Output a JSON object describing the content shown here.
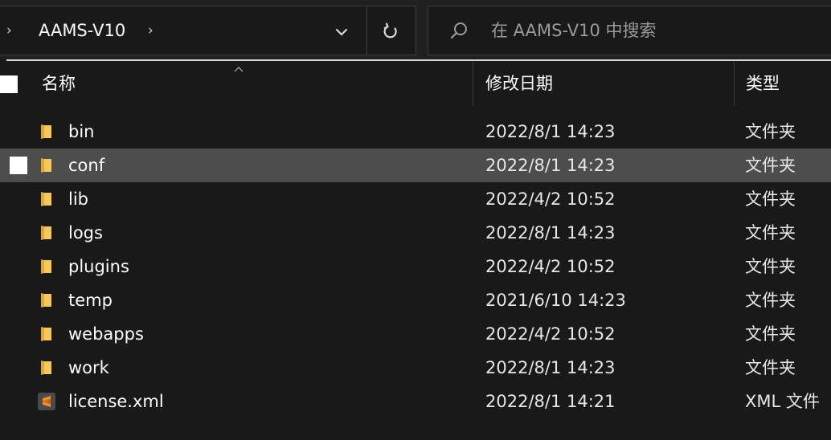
{
  "address_bar": {
    "breadcrumb": [
      {
        "label": "AAMS-V10"
      }
    ],
    "chevron_glyph": "›",
    "trailing_chevron_glyph": "›",
    "dropdown_icon": "chevron-down-icon",
    "refresh_icon": "refresh-icon"
  },
  "search": {
    "placeholder": "在 AAMS-V10 中搜索",
    "icon": "search-icon"
  },
  "columns": {
    "name": "名称",
    "date": "修改日期",
    "type": "类型",
    "sorted_by": "name",
    "sort_direction": "ascending"
  },
  "files": [
    {
      "name": "bin",
      "date": "2022/8/1 14:23",
      "type": "文件夹",
      "kind": "folder",
      "hovered": false
    },
    {
      "name": "conf",
      "date": "2022/8/1 14:23",
      "type": "文件夹",
      "kind": "folder",
      "hovered": true
    },
    {
      "name": "lib",
      "date": "2022/4/2 10:52",
      "type": "文件夹",
      "kind": "folder",
      "hovered": false
    },
    {
      "name": "logs",
      "date": "2022/8/1 14:23",
      "type": "文件夹",
      "kind": "folder",
      "hovered": false
    },
    {
      "name": "plugins",
      "date": "2022/4/2 10:52",
      "type": "文件夹",
      "kind": "folder",
      "hovered": false
    },
    {
      "name": "temp",
      "date": "2021/6/10 14:23",
      "type": "文件夹",
      "kind": "folder",
      "hovered": false
    },
    {
      "name": "webapps",
      "date": "2022/4/2 10:52",
      "type": "文件夹",
      "kind": "folder",
      "hovered": false
    },
    {
      "name": "work",
      "date": "2022/8/1 14:23",
      "type": "文件夹",
      "kind": "folder",
      "hovered": false
    },
    {
      "name": "license.xml",
      "date": "2022/8/1 14:21",
      "type": "XML 文件",
      "kind": "xml",
      "hovered": false
    }
  ],
  "colors": {
    "background": "#191919",
    "hover_row": "#4d4d4d",
    "folder_yellow": "#f2c14e",
    "xml_icon_bg": "#4a4a4a",
    "xml_icon_accent": "#f28c28"
  }
}
